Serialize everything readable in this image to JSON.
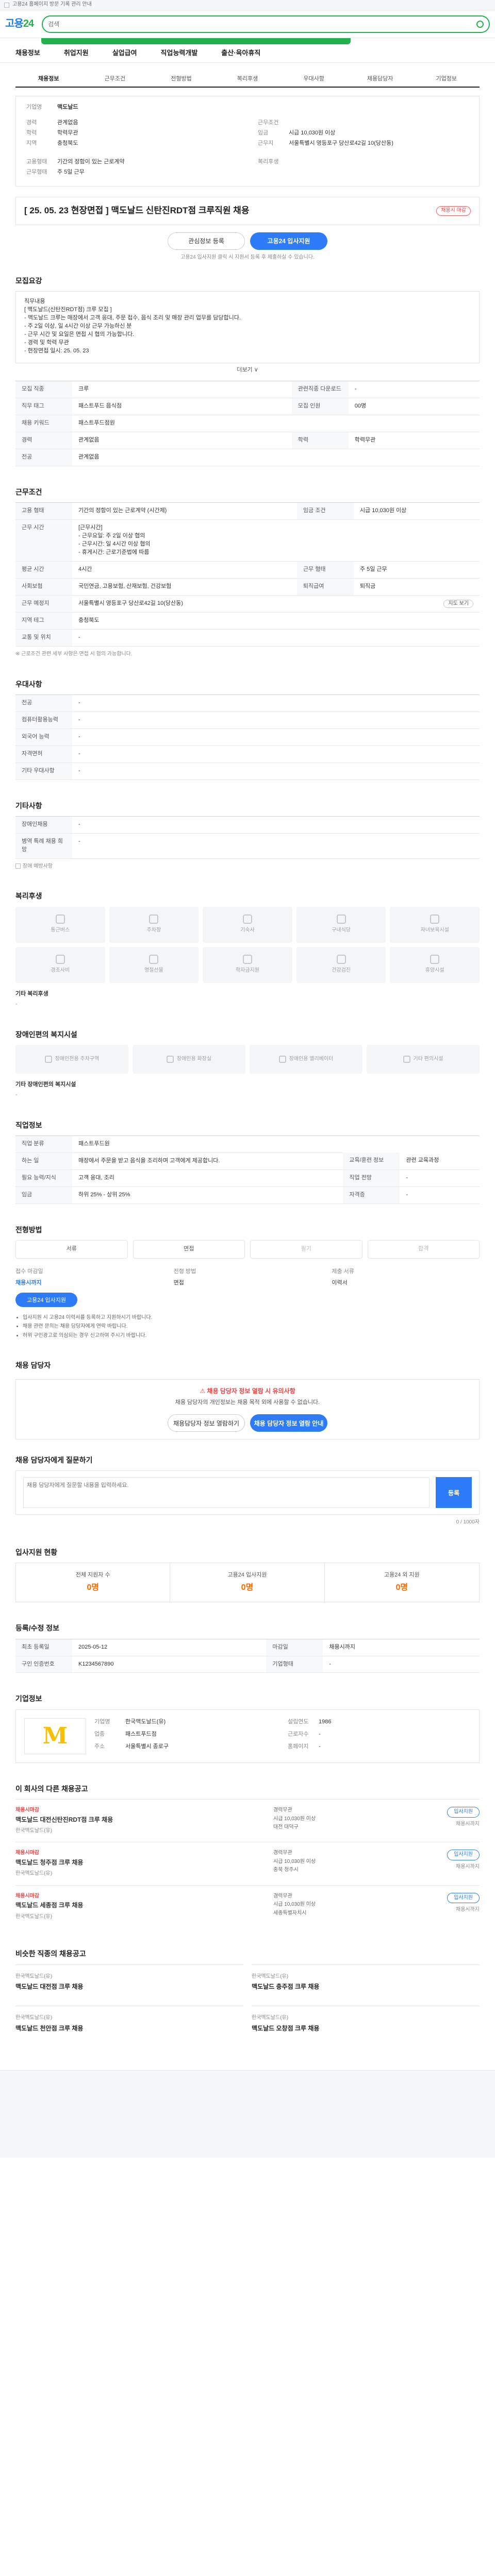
{
  "notice": {
    "text": "고용24 홈페이지 방문 기록 관리 안내"
  },
  "header": {
    "logo_main": "고용",
    "logo_num": "24",
    "search_placeholder": "검색"
  },
  "gnb": [
    "채용정보",
    "취업지원",
    "실업급여",
    "직업능력개발",
    "출산·육아휴직"
  ],
  "tabs": [
    "채용정보",
    "근무조건",
    "전형방법",
    "복리후생",
    "우대사항",
    "채용담당자",
    "기업정보"
  ],
  "summary": {
    "company_label": "기업명",
    "company": "맥도날드",
    "left": [
      {
        "k": "경력",
        "v": "관계없음"
      },
      {
        "k": "학력",
        "v": "학력무관"
      },
      {
        "k": "지역",
        "v": "충청북도"
      }
    ],
    "right": [
      {
        "k": "근무조건",
        "v": ""
      },
      {
        "k": "임금",
        "v": "시급 10,030원 이상"
      },
      {
        "k": "근무지",
        "v": "서울특별시 영등포구 당산로42길 10(당산동)"
      }
    ],
    "bottom_left": {
      "k": "고용형태",
      "v": "기간의 정함이 있는 근로계약"
    },
    "bottom_right": {
      "k": "복리후생",
      "v": ""
    },
    "bottom_left2": {
      "k": "근무형태",
      "v": "주 5일 근무"
    },
    "title": "[ 25. 05. 23 현장면접 ] 맥도날드 신탄진RDT점 크루직원 채용",
    "status": "채용시 마감",
    "btn_interest": "관심정보 등록",
    "btn_apply": "고용24 입사지원",
    "caption": "고용24 입사지원 클릭 시 지원서 등록 후 제출하실 수 있습니다."
  },
  "recruit": {
    "title": "모집요강",
    "desc": "직무내용\n[ 맥도날드(신탄진RDT점) 크루 모집 ]\n- 맥도날드 크루는 매장에서 고객 응대, 주문 접수, 음식 조리 및 매장 관리 업무를 담당합니다.\n- 주 2일 이상, 일 4시간 이상 근무 가능하신 분\n- 근무 시간 및 요일은 면접 시 협의 가능합니다.\n- 경력 및 학력 무관\n- 현장면접 일시: 25. 05. 23",
    "more": "더보기 ∨",
    "rows": [
      {
        "k": "모집 직종",
        "v": "크루",
        "k2": "관련직종 다운로드",
        "v2": "-"
      },
      {
        "k": "직무 태그",
        "v": "패스트푸드 음식점",
        "k2": "모집 인원",
        "v2": "00명"
      },
      {
        "k": "채용 키워드",
        "v": "패스트푸드점원",
        "k2": "",
        "v2": ""
      },
      {
        "k": "경력",
        "v": "관계없음",
        "k2": "학력",
        "v2": "학력무관"
      },
      {
        "k": "전공",
        "v": "관계없음",
        "k2": "",
        "v2": ""
      }
    ]
  },
  "conditions": {
    "title": "근무조건",
    "rows": [
      {
        "k": "고용 형태",
        "v": "기간의 정함이 있는 근로계약 (시간제)",
        "k2": "임금 조건",
        "v2": "시급 10,030원 이상"
      },
      {
        "k": "근무 시간",
        "v": "[근무시간]\n- 근무요일: 주 2일 이상 협의\n- 근무시간: 일 4시간 이상 협의\n- 휴게시간: 근로기준법에 따름",
        "k2": "",
        "v2": ""
      },
      {
        "k": "평균 시간",
        "v": "4시간",
        "k2": "근무 형태",
        "v2": "주 5일 근무"
      },
      {
        "k": "사회보험",
        "v": "국민연금, 고용보험, 산재보험, 건강보험",
        "k2": "퇴직급여",
        "v2": "퇴직금"
      },
      {
        "k": "근무 예정지",
        "v": "서울특별시 영등포구 당산로42길 10(당산동)",
        "k2": "",
        "v2": ""
      },
      {
        "k": "지역 테그",
        "v": "충청북도",
        "k2": "",
        "v2": ""
      },
      {
        "k": "교통 및 위치",
        "v": "-",
        "k2": "",
        "v2": ""
      }
    ],
    "map_button": "지도 보기",
    "note": "※ 근로조건 관련 세부 사항은 면접 시 협의 가능합니다."
  },
  "preference": {
    "title": "우대사항",
    "rows": [
      {
        "k": "전공",
        "v": "-"
      },
      {
        "k": "컴퓨터활용능력",
        "v": "-"
      },
      {
        "k": "외국어 능력",
        "v": "-"
      },
      {
        "k": "자격면허",
        "v": "-"
      },
      {
        "k": "기타 우대사항",
        "v": "-"
      }
    ]
  },
  "other": {
    "title": "기타사항",
    "rows": [
      {
        "k": "장애인채용",
        "v": "-"
      },
      {
        "k": "병역 특례 채용 희망",
        "v": "-"
      }
    ],
    "check_label": "장애 예방사항"
  },
  "welfare": {
    "title": "복리후생",
    "items": [
      "통근버스",
      "주차장",
      "기숙사",
      "구내식당",
      "자녀보육시설",
      "경조사비",
      "명절선물",
      "학자금지원",
      "건강검진",
      "휴양시설"
    ],
    "etc_label": "기타 복리후생",
    "etc_value": "-"
  },
  "disability": {
    "title": "장애인편의 복지시설",
    "items": [
      "장애인전용 주차구역",
      "장애인용 화장실",
      "장애인용 엘리베이터",
      "기타 편의시설"
    ],
    "etc_label": "기타 장애인편의 복지시설",
    "etc_value": "-"
  },
  "career": {
    "title": "직업정보",
    "rows": [
      {
        "k": "직업 분류",
        "v": "패스트푸드원"
      },
      {
        "k": "하는 일",
        "v": "매장에서 주문을 받고 음식을 조리하며 고객에게 제공합니다.",
        "k2": "교육/훈련 정보",
        "v2": "관련 교육과정"
      },
      {
        "k": "필요 능력/지식",
        "v": "고객 응대, 조리",
        "k2": "직업 전망",
        "v2": "-"
      },
      {
        "k": "임금",
        "v": "하위 25% - 상위 25%",
        "k2": "자격증",
        "v2": "-"
      }
    ]
  },
  "process": {
    "title": "전형방법",
    "steps": [
      "서류",
      "면접",
      "필기",
      "합격"
    ],
    "col1_label": "접수 마감일",
    "col1_value": "채용시까지",
    "col1_btn": "고용24 입사지원",
    "col2_label": "전형 방법",
    "col2_value": "면접",
    "col3_label": "제출 서류",
    "col3_value": "이력서",
    "bullets": [
      "입사지원 시 고용24 이력서를 등록하고 지원하시기 바랍니다.",
      "채용 관련 문의는 채용 담당자에게 연락 바랍니다.",
      "허위 구인광고로 의심되는 경우 신고하여 주시기 바랍니다."
    ]
  },
  "contact": {
    "title": "채용 담당자",
    "warn_head": "채용 담당자 정보 열람 시 유의사항",
    "warn_body": "채용 담당자의 개인정보는 채용 목적 외에 사용할 수 없습니다.",
    "btn_view": "채용담당자 정보 열람하기",
    "btn_contact": "채용 담당자 정보 열람 안내"
  },
  "question": {
    "title": "채용 담당자에게 질문하기",
    "placeholder": "채용 담당자에게 질문할 내용을 입력하세요.",
    "button": "등록",
    "counter": "0 / 1000자"
  },
  "stats": {
    "title": "입사지원 현황",
    "items": [
      {
        "l": "전체 지원자 수",
        "n": "0명"
      },
      {
        "l": "고용24 입사지원",
        "n": "0명"
      },
      {
        "l": "고용24 외 지원",
        "n": "0명"
      }
    ]
  },
  "reg": {
    "title": "등록/수정 정보",
    "rows": [
      {
        "k": "최초 등록일",
        "v": "2025-05-12",
        "k2": "마감일",
        "v2": "채용시까지"
      },
      {
        "k": "구인 인증번호",
        "v": "K1234567890",
        "k2": "기업형태",
        "v2": "-"
      }
    ]
  },
  "company": {
    "title": "기업정보",
    "logo": "M",
    "rows": [
      {
        "k": "기업명",
        "v": "한국맥도날드(유)"
      },
      {
        "k": "설립연도",
        "v": "1986"
      },
      {
        "k": "업종",
        "v": "패스트푸드점"
      },
      {
        "k": "근로자수",
        "v": "-"
      },
      {
        "k": "주소",
        "v": "서울특별시 종로구"
      },
      {
        "k": "홈페이지",
        "v": "-"
      }
    ]
  },
  "similar": {
    "title": "이 회사의 다른 채용공고",
    "jobs": [
      {
        "tag": "채용시마감",
        "title": "맥도날드 대전신탄진RDT점 크루 채용",
        "org": "한국맥도날드(유)",
        "l1": "경력무관",
        "l2": "시급 10,030원 이상",
        "l3": "대전 대덕구",
        "btn": "입사지원",
        "d": "채용시까지"
      },
      {
        "tag": "채용시마감",
        "title": "맥도날드 청주점 크루 채용",
        "org": "한국맥도날드(유)",
        "l1": "경력무관",
        "l2": "시급 10,030원 이상",
        "l3": "충북 청주시",
        "btn": "입사지원",
        "d": "채용시까지"
      },
      {
        "tag": "채용시마감",
        "title": "맥도날드 세종점 크루 채용",
        "org": "한국맥도날드(유)",
        "l1": "경력무관",
        "l2": "시급 10,030원 이상",
        "l3": "세종특별자치시",
        "btn": "입사지원",
        "d": "채용시까지"
      }
    ]
  },
  "related": {
    "title": "비슷한 직종의 채용공고",
    "items": [
      {
        "org": "한국맥도날드(유)",
        "title": "맥도날드 대전점 크루 채용"
      },
      {
        "org": "한국맥도날드(유)",
        "title": "맥도날드 충주점 크루 채용"
      },
      {
        "org": "한국맥도날드(유)",
        "title": "맥도날드 천안점 크루 채용"
      },
      {
        "org": "한국맥도날드(유)",
        "title": "맥도날드 오창점 크루 채용"
      }
    ]
  }
}
